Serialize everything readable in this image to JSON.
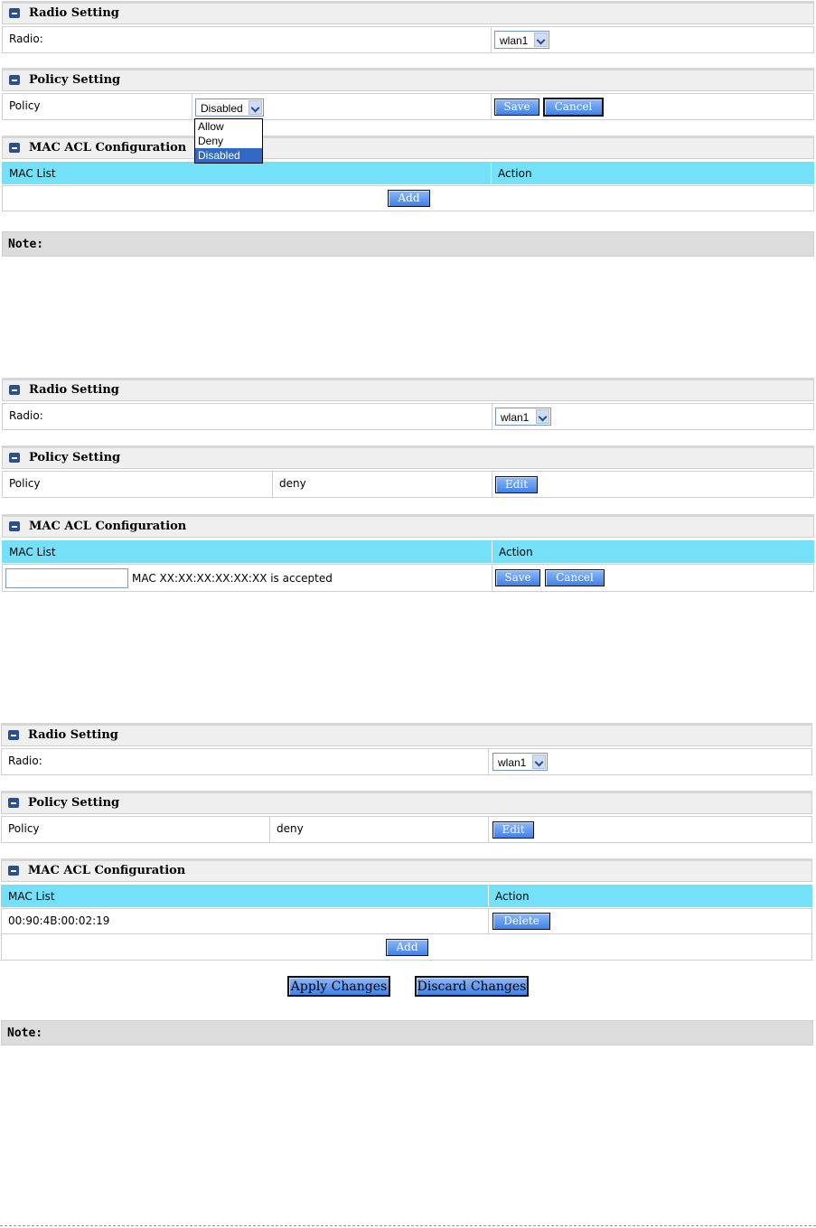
{
  "sections": {
    "radio_setting": "Radio Setting",
    "policy_setting": "Policy Setting",
    "mac_acl": "MAC ACL Configuration"
  },
  "labels": {
    "radio": "Radio:",
    "policy": "Policy",
    "mac_list": "MAC List",
    "action": "Action",
    "note": "Note:"
  },
  "radio_value": "wlan1",
  "screen1": {
    "policy_select": "Disabled",
    "policy_options": [
      "Allow",
      "Deny",
      "Disabled"
    ],
    "save": "Save",
    "cancel": "Cancel",
    "add": "Add"
  },
  "screen2": {
    "policy_value": "deny",
    "edit": "Edit",
    "mac_input_value": "",
    "mac_hint": "MAC XX:XX:XX:XX:XX:XX is accepted",
    "save": "Save",
    "cancel": "Cancel"
  },
  "screen3": {
    "policy_value": "deny",
    "edit": "Edit",
    "mac_entry": "00:90:4B:00:02:19",
    "delete": "Delete",
    "add": "Add",
    "apply": "Apply Changes",
    "discard": "Discard Changes"
  }
}
